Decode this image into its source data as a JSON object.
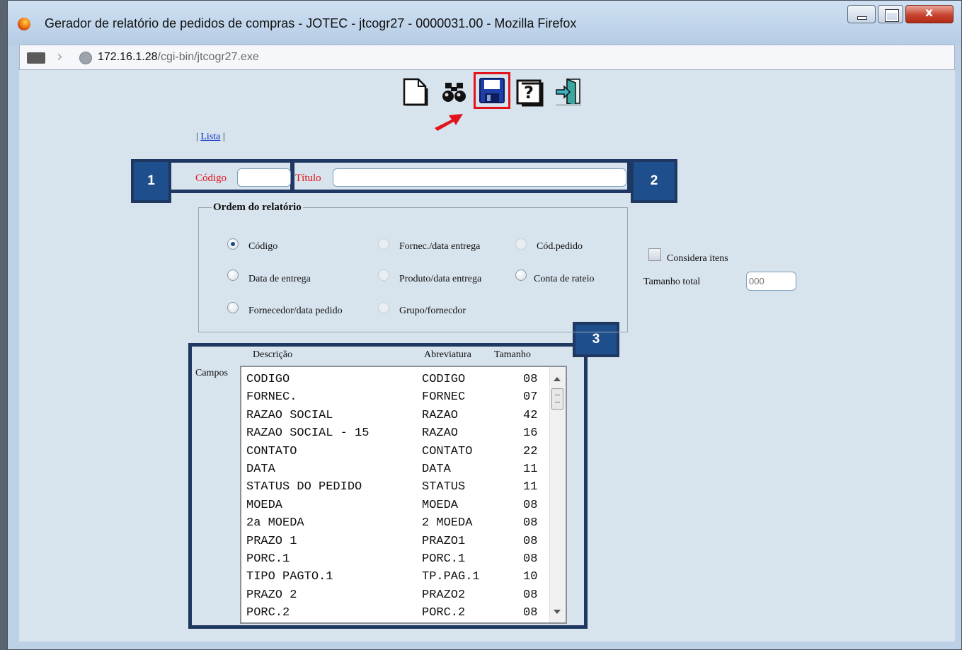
{
  "window": {
    "title": "Gerador de relatório de pedidos de compras - JOTEC - jtcogr27 - 0000031.00 - Mozilla Firefox",
    "url_host": "172.16.1.28",
    "url_path": "/cgi-bin/jtcogr27.exe"
  },
  "toolbar": {
    "icons": [
      "new-document-icon",
      "find-binoculars-icon",
      "save-floppy-icon",
      "help-icon",
      "exit-door-icon"
    ],
    "highlight_color": "#e3131b"
  },
  "nav": {
    "sep_left": "|",
    "lista": "Lista",
    "sep_right": "|"
  },
  "callouts": [
    "1",
    "2",
    "3"
  ],
  "form": {
    "codigo_label": "Código",
    "codigo_value": "",
    "titulo_label": "Título",
    "titulo_value": ""
  },
  "order": {
    "legend": "Ordem do relatório",
    "options": [
      {
        "label": "Código",
        "checked": true,
        "enabled": true
      },
      {
        "label": "Fornec./data entrega",
        "checked": false,
        "enabled": false
      },
      {
        "label": "Cód.pedido",
        "checked": false,
        "enabled": false
      },
      {
        "label": "Data de entrega",
        "checked": false,
        "enabled": true
      },
      {
        "label": "Produto/data entrega",
        "checked": false,
        "enabled": false
      },
      {
        "label": "Conta de rateio",
        "checked": false,
        "enabled": true
      },
      {
        "label": "Fornecedor/data pedido",
        "checked": false,
        "enabled": true
      },
      {
        "label": "Grupo/fornecdor",
        "checked": false,
        "enabled": false
      }
    ]
  },
  "options_panel": {
    "considera_itens": "Considera itens",
    "tamanho_total_label": "Tamanho total",
    "tamanho_total_placeholder": "000"
  },
  "fields": {
    "label": "Campos",
    "headers": {
      "descricao": "Descrição",
      "abreviatura": "Abreviatura",
      "tamanho": "Tamanho"
    },
    "rows": [
      {
        "desc": "CODIGO",
        "abbr": "CODIGO",
        "size": "08"
      },
      {
        "desc": "FORNEC.",
        "abbr": "FORNEC",
        "size": "07"
      },
      {
        "desc": "RAZAO SOCIAL",
        "abbr": "RAZAO",
        "size": "42"
      },
      {
        "desc": "RAZAO SOCIAL - 15",
        "abbr": "RAZAO",
        "size": "16"
      },
      {
        "desc": "CONTATO",
        "abbr": "CONTATO",
        "size": "22"
      },
      {
        "desc": "DATA",
        "abbr": "DATA",
        "size": "11"
      },
      {
        "desc": "STATUS DO PEDIDO",
        "abbr": "STATUS",
        "size": "11"
      },
      {
        "desc": "MOEDA",
        "abbr": "MOEDA",
        "size": "08"
      },
      {
        "desc": "2a MOEDA",
        "abbr": "2 MOEDA",
        "size": "08"
      },
      {
        "desc": "PRAZO 1",
        "abbr": "PRAZO1",
        "size": "08"
      },
      {
        "desc": "PORC.1",
        "abbr": "PORC.1",
        "size": "08"
      },
      {
        "desc": "TIPO PAGTO.1",
        "abbr": "TP.PAG.1",
        "size": "10"
      },
      {
        "desc": "PRAZO 2",
        "abbr": "PRAZO2",
        "size": "08"
      },
      {
        "desc": "PORC.2",
        "abbr": "PORC.2",
        "size": "08"
      }
    ]
  }
}
